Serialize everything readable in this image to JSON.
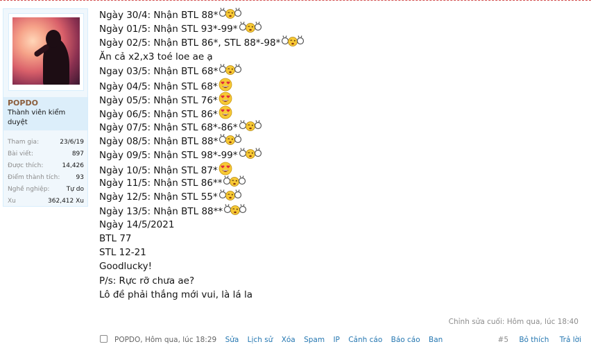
{
  "user": {
    "username": "POPDO",
    "title": "Thành viên kiểm duyệt",
    "stats": [
      {
        "label": "Tham gia:",
        "value": "23/6/19"
      },
      {
        "label": "Bài viết:",
        "value": "897"
      },
      {
        "label": "Được thích:",
        "value": "14,426"
      },
      {
        "label": "Điểm thành tích:",
        "value": "93"
      },
      {
        "label": "Nghề nghiệp:",
        "value": "Tự do"
      },
      {
        "label": "Xu",
        "value": "362,412 Xu"
      }
    ]
  },
  "post": {
    "lines": [
      {
        "text": "Ngày 30/4: Nhận BTL 88*",
        "emoji": "ok-hands-wink-icon"
      },
      {
        "text": "Ngày 01/5: Nhận STL 93*-99*",
        "emoji": "ok-hands-wink-icon"
      },
      {
        "text": "Ngày 02/5: Nhận BTL 86*, STL 88*-98*",
        "emoji": "ok-hands-wink-icon"
      },
      {
        "text": "Ăn cả x2,x3 toé loe ae ạ",
        "emoji": ""
      },
      {
        "text": "Ngay 03/5: Nhận BTL 68*",
        "emoji": "ok-hands-wink-icon"
      },
      {
        "text": "Ngày 04/5: Nhận STL 68*",
        "emoji": "heart-eyes-icon"
      },
      {
        "text": "Ngày 05/5: Nhận STL 76*",
        "emoji": "heart-eyes-icon"
      },
      {
        "text": "Ngày 06/5: Nhận STL 86*",
        "emoji": "heart-eyes-icon"
      },
      {
        "text": "Ngày 07/5: Nhận STL 68*-86*",
        "emoji": "ok-hands-wink-icon"
      },
      {
        "text": "Ngày 08/5: Nhận BTL 88*",
        "emoji": "ok-hands-wink-icon"
      },
      {
        "text": "Ngày 09/5: Nhận STL 98*-99*",
        "emoji": "ok-hands-wink-icon"
      },
      {
        "text": "Ngày 10/5: Nhận STL 87*",
        "emoji": "heart-eyes-icon"
      },
      {
        "text": "Ngày 11/5: Nhận STL 86**",
        "emoji": "ok-hands-wink-icon"
      },
      {
        "text": "Ngày 12/5: Nhận STL 55*",
        "emoji": "ok-hands-wink-icon"
      },
      {
        "text": "Ngày 13/5: Nhận BTL 88**",
        "emoji": "ok-hands-wink-icon"
      },
      {
        "text": "Ngày 14/5/2021",
        "emoji": ""
      },
      {
        "text": "BTL 77",
        "emoji": ""
      },
      {
        "text": "STL 12-21",
        "emoji": ""
      },
      {
        "text": "Goodlucky!",
        "emoji": ""
      },
      {
        "text": "P/s: Rực rỡ chưa ae?",
        "emoji": ""
      },
      {
        "text": "Lô đề phải thắng mới vui, là lá la",
        "emoji": ""
      }
    ],
    "edit_note": "Chỉnh sửa cuối: Hôm qua, lúc 18:40"
  },
  "footer": {
    "author_time": "POPDO, Hôm qua, lúc 18:29",
    "actions": [
      "Sửa",
      "Lịch sử",
      "Xóa",
      "Spam",
      "IP",
      "Cảnh cáo",
      "Báo cáo",
      "Ban"
    ],
    "post_number": "#5",
    "unlike": "Bỏ thích",
    "reply": "Trả lời"
  },
  "colors": {
    "link": "#2577b1",
    "username": "#8b5e3c",
    "panel_bg": "#f0f7fc",
    "top_border": "#d24b4b"
  }
}
